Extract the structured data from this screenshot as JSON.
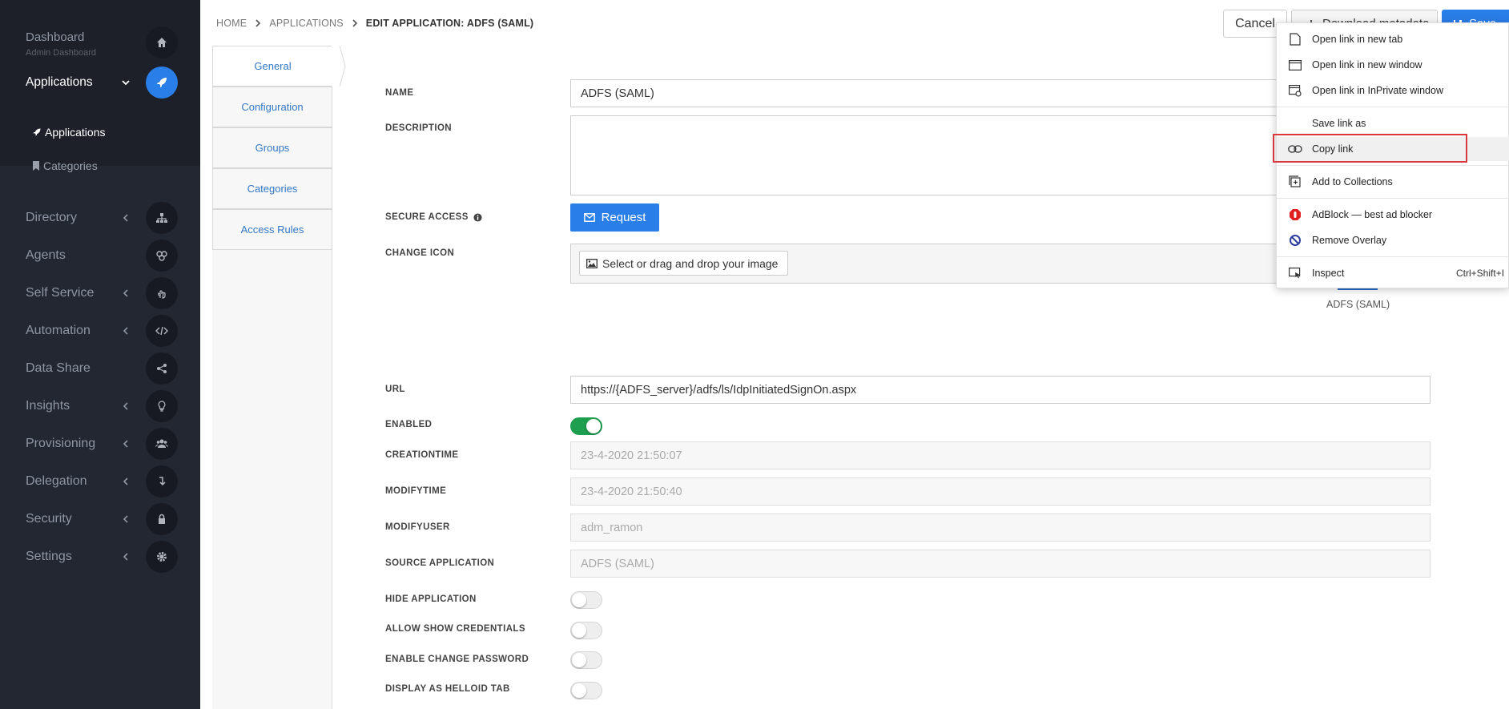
{
  "sidebar": {
    "dashboard": {
      "label": "Dashboard",
      "sub": "Admin Dashboard"
    },
    "applications": {
      "label": "Applications"
    },
    "subitems": [
      {
        "label": "Applications"
      },
      {
        "label": "Categories"
      }
    ],
    "items": [
      {
        "label": "Directory",
        "icon": "sitemap-icon"
      },
      {
        "label": "Agents",
        "icon": "agents-icon"
      },
      {
        "label": "Self Service",
        "icon": "hand-pointer-icon"
      },
      {
        "label": "Automation",
        "icon": "code-icon"
      },
      {
        "label": "Data Share",
        "icon": "share-icon"
      },
      {
        "label": "Insights",
        "icon": "lightbulb-icon"
      },
      {
        "label": "Provisioning",
        "icon": "users-icon"
      },
      {
        "label": "Delegation",
        "icon": "delegation-icon"
      },
      {
        "label": "Security",
        "icon": "lock-icon"
      },
      {
        "label": "Settings",
        "icon": "gear-icon"
      }
    ]
  },
  "breadcrumb": {
    "home": "HOME",
    "section": "APPLICATIONS",
    "current": "EDIT APPLICATION: ADFS (SAML)"
  },
  "header": {
    "cancel": "Cancel",
    "download": "Download metadata",
    "save": "Save"
  },
  "tabs": [
    "General",
    "Configuration",
    "Groups",
    "Categories",
    "Access Rules"
  ],
  "form": {
    "name": {
      "label": "NAME",
      "value": "ADFS (SAML)"
    },
    "description": {
      "label": "DESCRIPTION",
      "value": ""
    },
    "secure_access": {
      "label": "SECURE ACCESS",
      "button": "Request"
    },
    "change_icon": {
      "label": "CHANGE ICON",
      "button": "Select or drag and drop your image"
    },
    "preview_label": "ADFS (SAML)",
    "url": {
      "label": "URL",
      "value": "https://{ADFS_server}/adfs/ls/IdpInitiatedSignOn.aspx"
    },
    "enabled": {
      "label": "ENABLED",
      "value": true
    },
    "creationtime": {
      "label": "CREATIONTIME",
      "value": "23-4-2020 21:50:07"
    },
    "modifytime": {
      "label": "MODIFYTIME",
      "value": "23-4-2020 21:50:40"
    },
    "modifyuser": {
      "label": "MODIFYUSER",
      "value": "adm_ramon"
    },
    "source_application": {
      "label": "SOURCE APPLICATION",
      "value": "ADFS (SAML)"
    },
    "hide_application": {
      "label": "HIDE APPLICATION",
      "value": false
    },
    "allow_show_credentials": {
      "label": "ALLOW SHOW CREDENTIALS",
      "value": false
    },
    "enable_change_password": {
      "label": "ENABLE CHANGE PASSWORD",
      "value": false
    },
    "display_as_helloid_tab": {
      "label": "DISPLAY AS HELLOID TAB",
      "value": false
    }
  },
  "context_menu": {
    "items": [
      {
        "label": "Open link in new tab",
        "icon": "new-tab-icon"
      },
      {
        "label": "Open link in new window",
        "icon": "new-window-icon"
      },
      {
        "label": "Open link in InPrivate window",
        "icon": "inprivate-icon"
      },
      {
        "label": "Save link as",
        "icon": ""
      },
      {
        "label": "Copy link",
        "icon": "link-icon"
      },
      {
        "label": "Add to Collections",
        "icon": "collections-icon"
      },
      {
        "label": "AdBlock — best ad blocker",
        "icon": "adblock-icon"
      },
      {
        "label": "Remove Overlay",
        "icon": "remove-overlay-icon"
      },
      {
        "label": "Inspect",
        "icon": "inspect-icon",
        "shortcut": "Ctrl+Shift+I"
      }
    ]
  },
  "colors": {
    "accent": "#2a7ee8",
    "sidebar": "#222732",
    "toggle_on": "#1e9e4f",
    "highlight": "#d9383d"
  }
}
